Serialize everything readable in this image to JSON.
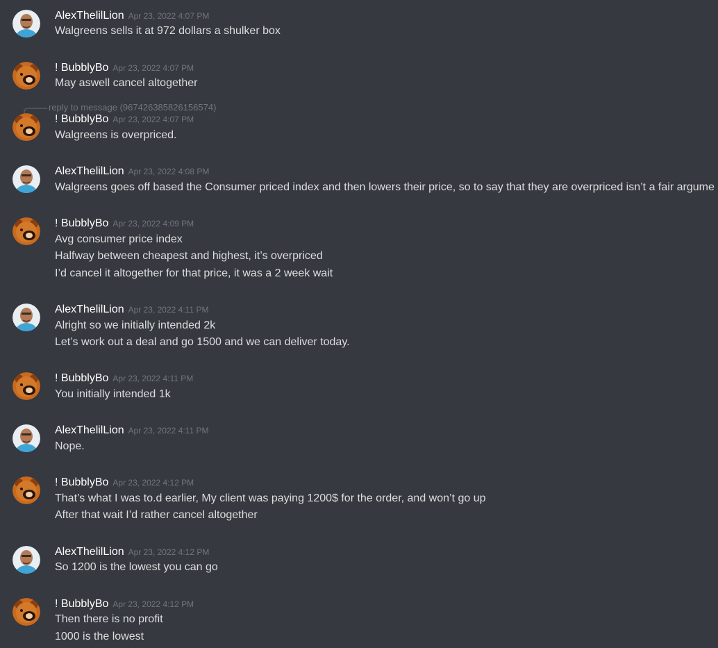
{
  "users": {
    "alex": {
      "name": "AlexThelilLion",
      "avatar_icon": "person-avatar-icon"
    },
    "bubbly": {
      "name": "! BubblyBo",
      "avatar_icon": "bear-avatar-icon"
    }
  },
  "colors": {
    "background": "#36393f",
    "username": "#ffffff",
    "text": "#dcddde",
    "timestamp": "#72767d"
  },
  "messages": [
    {
      "author": "AlexThelilLion",
      "time": "Apr 23, 2022 4:07 PM",
      "lines": [
        "Walgreens sells it at 972 dollars a shulker box"
      ]
    },
    {
      "author": "! BubblyBo",
      "time": "Apr 23, 2022 4:07 PM",
      "lines": [
        "May aswell cancel altogether"
      ]
    },
    {
      "author": "! BubblyBo",
      "time": "Apr 23, 2022 4:07 PM",
      "reply": "reply to message (967426385826156574)",
      "lines": [
        "Walgreens is overpriced."
      ]
    },
    {
      "author": "AlexThelilLion",
      "time": "Apr 23, 2022 4:08 PM",
      "lines": [
        "Walgreens goes off based the Consumer priced index and then lowers their price, so to say that they are overpriced isn’t a fair argume"
      ]
    },
    {
      "author": "! BubblyBo",
      "time": "Apr 23, 2022 4:09 PM",
      "lines": [
        "Avg consumer price index",
        "Halfway between cheapest and highest, it’s overpriced",
        "I’d cancel it altogether for that price, it was a 2 week wait"
      ]
    },
    {
      "author": "AlexThelilLion",
      "time": "Apr 23, 2022 4:11 PM",
      "lines": [
        "Alright so we initially intended 2k",
        "Let’s work out a deal and go 1500 and we can deliver today."
      ]
    },
    {
      "author": "! BubblyBo",
      "time": "Apr 23, 2022 4:11 PM",
      "lines": [
        "You initially intended 1k"
      ]
    },
    {
      "author": "AlexThelilLion",
      "time": "Apr 23, 2022 4:11 PM",
      "lines": [
        "Nope."
      ]
    },
    {
      "author": "! BubblyBo",
      "time": "Apr 23, 2022 4:12 PM",
      "lines": [
        "That’s what I was to.d earlier, My client was paying 1200$ for the order, and won’t go up",
        "After that wait I’d rather cancel altogether"
      ]
    },
    {
      "author": "AlexThelilLion",
      "time": "Apr 23, 2022 4:12 PM",
      "lines": [
        "So 1200 is the lowest you can go"
      ]
    },
    {
      "author": "! BubblyBo",
      "time": "Apr 23, 2022 4:12 PM",
      "lines": [
        "Then there is no profit",
        "1000 is the lowest"
      ]
    }
  ]
}
